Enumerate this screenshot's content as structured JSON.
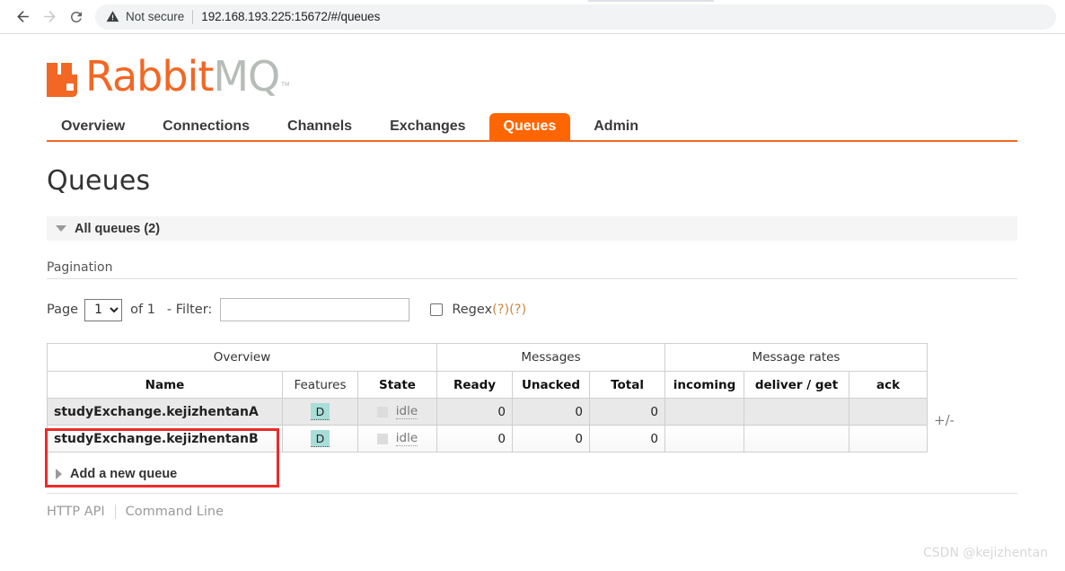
{
  "browser": {
    "back_icon": "back-arrow-icon",
    "forward_icon": "forward-arrow-icon",
    "reload_icon": "reload-icon",
    "warning_icon": "warning-triangle-icon",
    "security_text": "Not secure",
    "url": "192.168.193.225:15672/#/queues"
  },
  "logo": {
    "mark": "rabbitmq-logo-icon",
    "name_primary": "Rabbit",
    "name_secondary": "MQ",
    "trademark": "™",
    "primary_color": "#f26724",
    "secondary_color": "#b6bdb8"
  },
  "nav": {
    "items": [
      {
        "label": "Overview",
        "active": false
      },
      {
        "label": "Connections",
        "active": false
      },
      {
        "label": "Channels",
        "active": false
      },
      {
        "label": "Exchanges",
        "active": false
      },
      {
        "label": "Queues",
        "active": true
      },
      {
        "label": "Admin",
        "active": false
      }
    ],
    "active_bg": "#ff6600"
  },
  "page": {
    "title": "Queues",
    "section_header": "All queues (2)",
    "section_collapse_icon": "triangle-down-icon"
  },
  "pagination": {
    "heading": "Pagination",
    "page_word": "Page",
    "page_value": "1",
    "page_options": [
      "1"
    ],
    "of_count": "of 1",
    "filter_label": "- Filter:",
    "filter_value": "",
    "filter_placeholder": "",
    "regex_label": "Regex",
    "regex_checked": false,
    "help_one": "(?)",
    "help_two": "(?)"
  },
  "table": {
    "group_headers": [
      {
        "label": "Overview",
        "span": 3
      },
      {
        "label": "Messages",
        "span": 3
      },
      {
        "label": "Message rates",
        "span": 3
      }
    ],
    "columns": [
      {
        "label": "Name",
        "bold": true,
        "align": "left"
      },
      {
        "label": "Features",
        "bold": false,
        "align": "center"
      },
      {
        "label": "State",
        "bold": true,
        "align": "center"
      },
      {
        "label": "Ready",
        "bold": true,
        "align": "center"
      },
      {
        "label": "Unacked",
        "bold": true,
        "align": "center"
      },
      {
        "label": "Total",
        "bold": true,
        "align": "center"
      },
      {
        "label": "incoming",
        "bold": true,
        "align": "center"
      },
      {
        "label": "deliver / get",
        "bold": true,
        "align": "center"
      },
      {
        "label": "ack",
        "bold": true,
        "align": "center"
      }
    ],
    "toggle_columns": "+/-",
    "rows": [
      {
        "name": "studyExchange.kejizhentanA",
        "features": "D",
        "state": "idle",
        "ready": "0",
        "unacked": "0",
        "total": "0",
        "incoming": "",
        "deliver_get": "",
        "ack": ""
      },
      {
        "name": "studyExchange.kejizhentanB",
        "features": "D",
        "state": "idle",
        "ready": "0",
        "unacked": "0",
        "total": "0",
        "incoming": "",
        "deliver_get": "",
        "ack": ""
      }
    ],
    "feature_badge_color": "#a8ddd8"
  },
  "add_queue": {
    "label": "Add a new queue",
    "expand_icon": "triangle-right-icon"
  },
  "footer": {
    "http_api": "HTTP API",
    "command_line": "Command Line"
  },
  "watermark": "CSDN @kejizhentan",
  "annotation": {
    "color": "#ef2929",
    "target": "queue-name-column"
  }
}
